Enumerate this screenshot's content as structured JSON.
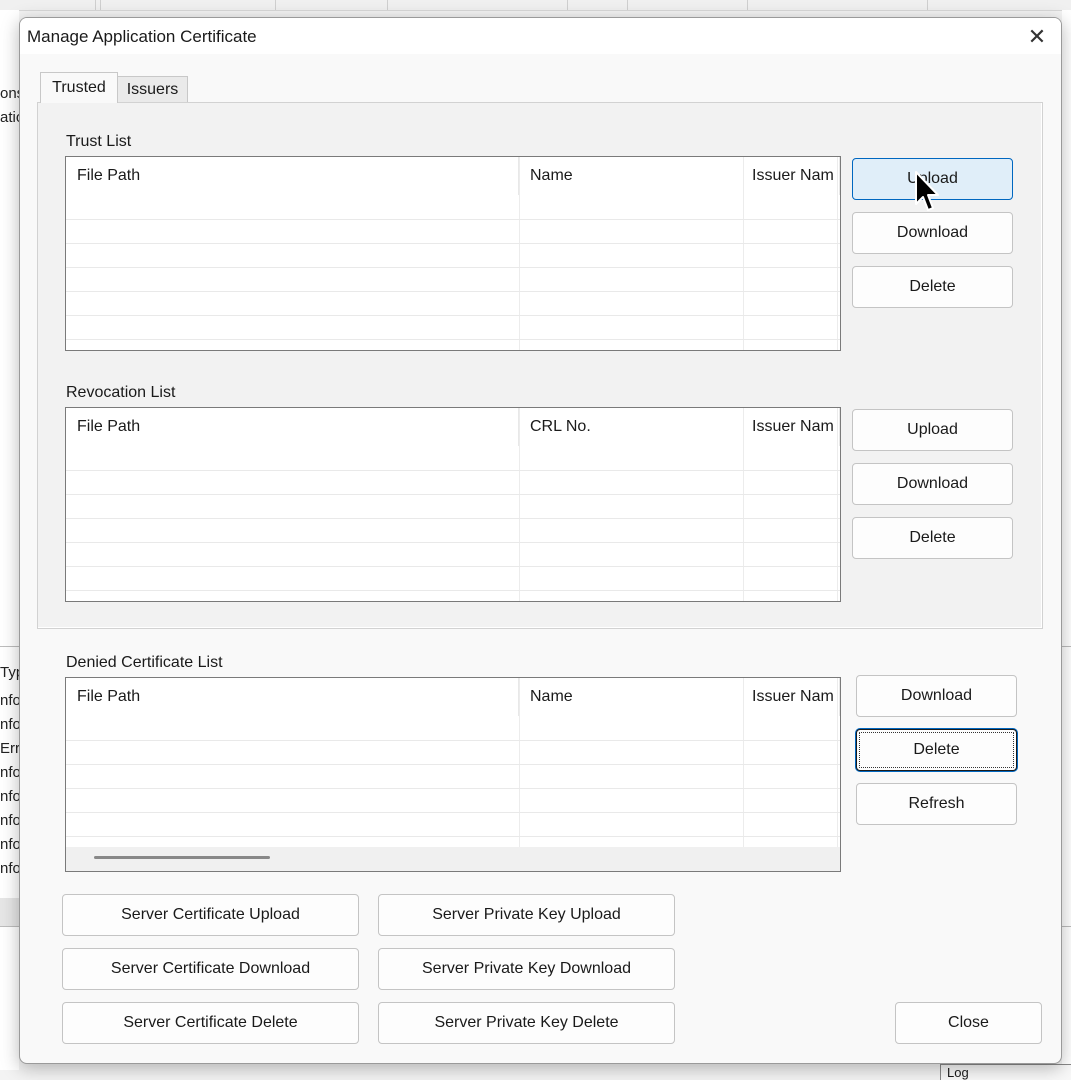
{
  "dialog": {
    "title": "Manage Application Certificate",
    "tabs": [
      {
        "label": "Trusted",
        "active": true
      },
      {
        "label": "Issuers",
        "active": false
      }
    ],
    "trust_list": {
      "label": "Trust List",
      "columns": [
        "File Path",
        "Name",
        "Issuer Nam"
      ],
      "buttons": {
        "upload": "Upload",
        "download": "Download",
        "delete": "Delete"
      }
    },
    "revocation_list": {
      "label": "Revocation List",
      "columns": [
        "File Path",
        "CRL No.",
        "Issuer Nam"
      ],
      "buttons": {
        "upload": "Upload",
        "download": "Download",
        "delete": "Delete"
      }
    },
    "denied_list": {
      "label": "Denied Certificate List",
      "columns": [
        "File Path",
        "Name",
        "Issuer Nam"
      ],
      "buttons": {
        "download": "Download",
        "delete": "Delete",
        "refresh": "Refresh"
      }
    },
    "server_buttons": {
      "cert_upload": "Server Certificate Upload",
      "cert_download": "Server Certificate Download",
      "cert_delete": "Server Certificate Delete",
      "key_upload": "Server Private Key Upload",
      "key_download": "Server Private Key Download",
      "key_delete": "Server Private Key Delete"
    },
    "close_label": "Close"
  },
  "background": {
    "left_fragments_top": [
      "ons",
      "atio"
    ],
    "left_fragments_log": [
      "Typ",
      "nfo",
      "nfo",
      "Erro",
      "nfo",
      "nfo",
      "nfo",
      "nfo",
      "nfo"
    ],
    "bottom_right_fragment": "Log"
  },
  "colors": {
    "hover_fill": "#e0eef9",
    "focus_accent": "#0067c0"
  }
}
